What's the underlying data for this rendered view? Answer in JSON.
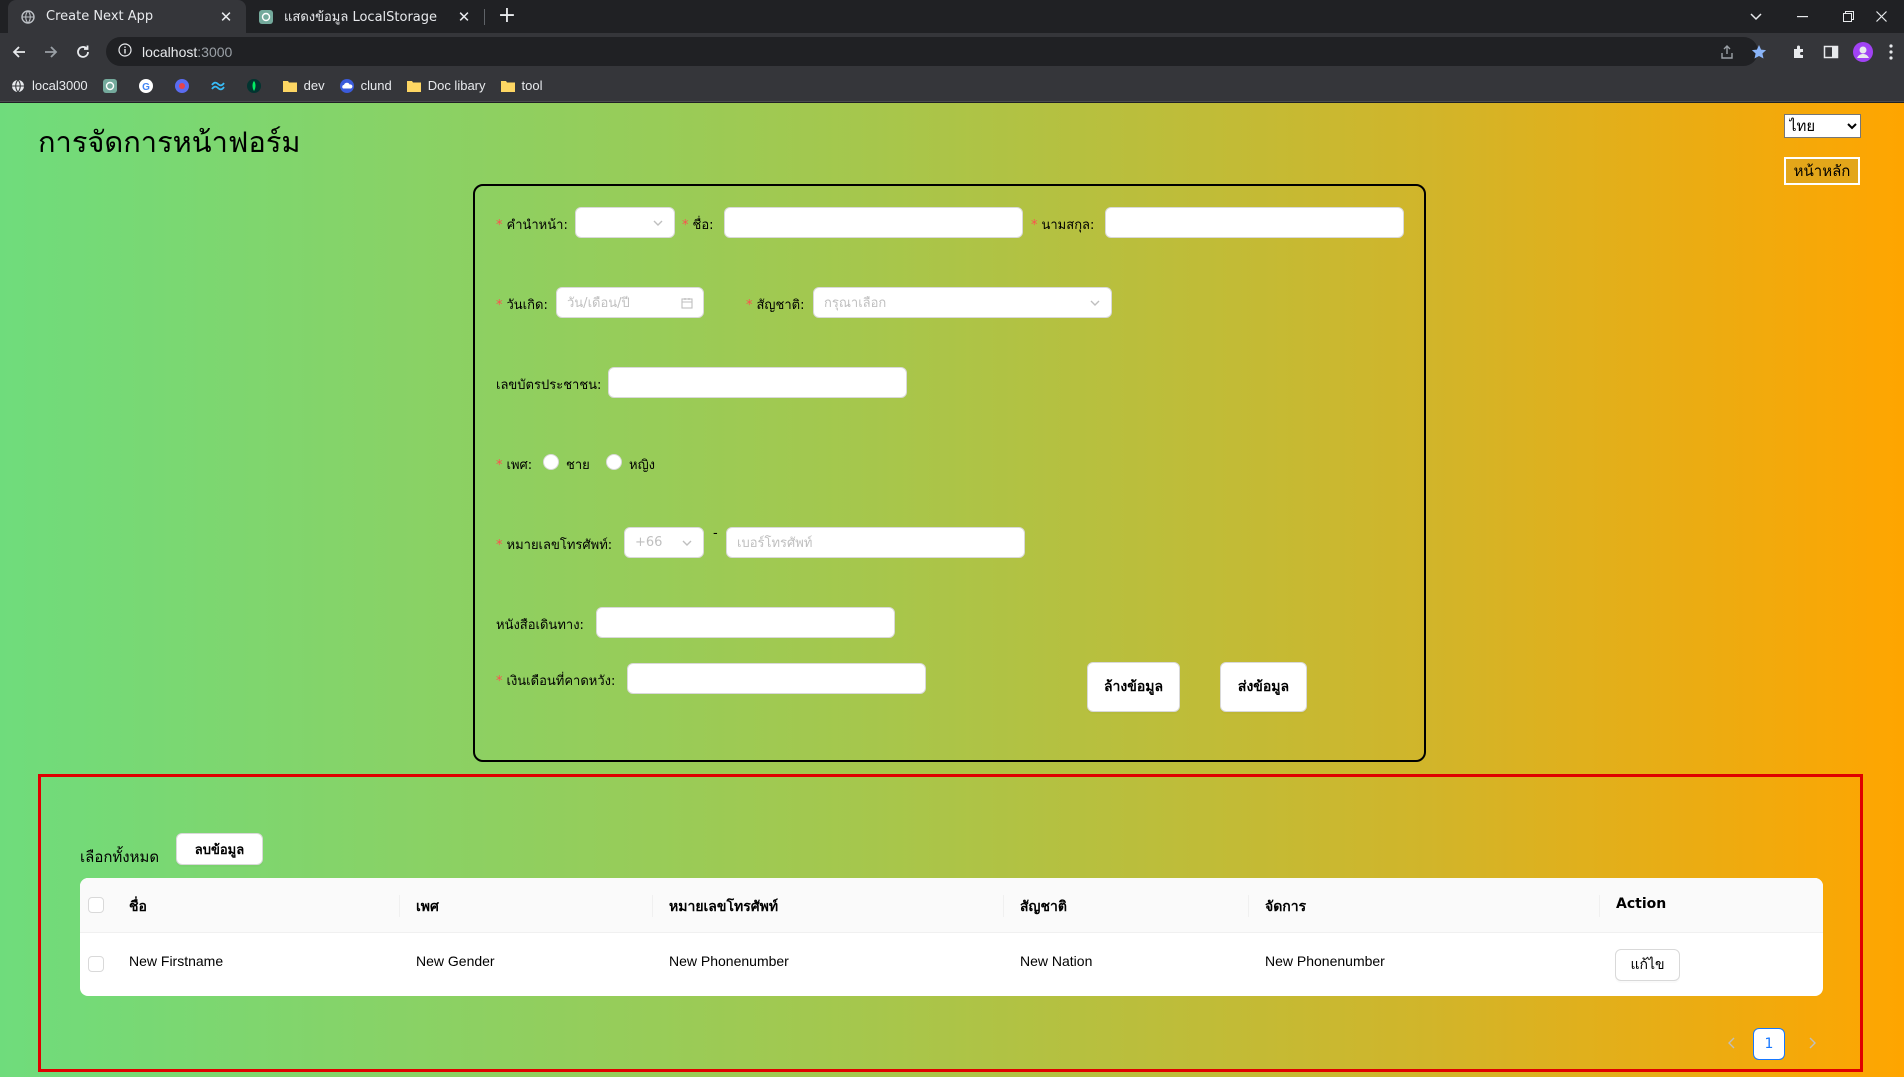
{
  "browser": {
    "tabs": [
      {
        "title": "Create Next App",
        "active": true
      },
      {
        "title": "แสดงข้อมูล LocalStorage",
        "active": false
      }
    ],
    "url_host": "localhost",
    "url_port": ":3000",
    "bookmarks": [
      "local3000",
      "dev",
      "clund",
      "Doc libary",
      "tool"
    ]
  },
  "page": {
    "title": "การจัดการหน้าฟอร์ม",
    "language_selected": "ไทย",
    "home_button": "หน้าหลัก"
  },
  "form": {
    "title_prefix_label": "คำนำหน้า:",
    "first_name_label": "ชื่อ:",
    "last_name_label": "นามสกุล:",
    "birthdate_label": "วันเกิด:",
    "birthdate_placeholder": "วัน/เดือน/ปี",
    "nationality_label": "สัญชาติ:",
    "nationality_placeholder": "กรุณาเลือก",
    "id_card_label": "เลขบัตรประชาชน:",
    "gender_label": "เพศ:",
    "gender_options": [
      "ชาย",
      "หญิง"
    ],
    "phone_label": "หมายเลขโทรศัพท์:",
    "phone_code": "+66",
    "phone_separator": "-",
    "phone_placeholder": "เบอร์โทรศัพท์",
    "passport_label": "หนังสือเดินทาง:",
    "salary_label": "เงินเดือนที่คาดหวัง:",
    "clear_button": "ล้างข้อมูล",
    "submit_button": "ส่งข้อมูล"
  },
  "table": {
    "select_all_label": "เลือกทั้งหมด",
    "delete_button": "ลบข้อมูล",
    "columns": [
      "ชื่อ",
      "เพศ",
      "หมายเลขโทรศัพท์",
      "สัญชาติ",
      "จัดการ",
      "Action"
    ],
    "rows": [
      {
        "name": "New Firstname",
        "gender": "New Gender",
        "phone": "New Phonenumber",
        "nation": "New Nation",
        "manage": "New Phonenumber",
        "action": "แก้ไข"
      }
    ],
    "current_page": "1"
  },
  "colors": {
    "required": "#ff4d4f",
    "table_border": "#e00000",
    "pagination_active": "#1677ff",
    "gradient_start": "#6fdc7c",
    "gradient_end": "#ffa500"
  }
}
